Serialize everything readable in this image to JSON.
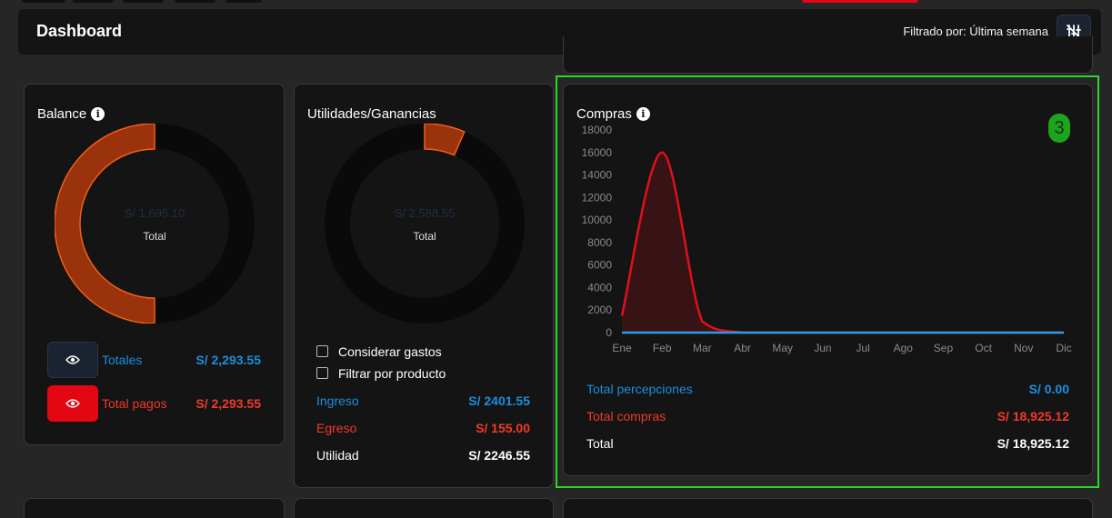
{
  "header": {
    "title": "Dashboard",
    "filter_text": "Filtrado por: Última semana",
    "filter_icon": "sliders-off-icon"
  },
  "balance": {
    "title": "Balance",
    "center_value": "S/ 1,695.10",
    "center_label": "Total",
    "totales_label": "Totales",
    "totales_value": "S/ 2,293.55",
    "total_pagos_label": "Total pagos",
    "total_pagos_value": "S/ 2,293.55",
    "ring_fraction": 0.5,
    "colors": {
      "ring": "#9a320c",
      "ring_stroke": "#f0601a",
      "track": "#0a0a0a",
      "eye_dark": "#1b2230",
      "eye_red": "#e30613"
    }
  },
  "utilidades": {
    "title": "Utilidades/Ganancias",
    "center_value": "S/ 2,588.55",
    "center_label": "Total",
    "checkbox_gastos": "Considerar gastos",
    "checkbox_producto": "Filtrar por producto",
    "ingreso_label": "Ingreso",
    "ingreso_value": "S/ 2401.55",
    "egreso_label": "Egreso",
    "egreso_value": "S/ 155.00",
    "utilidad_label": "Utilidad",
    "utilidad_value": "S/ 2246.55",
    "ring_fraction": 0.065
  },
  "compras": {
    "title": "Compras",
    "badge": "3",
    "total_percepciones_label": "Total percepciones",
    "total_percepciones_value": "S/ 0.00",
    "total_compras_label": "Total compras",
    "total_compras_value": "S/ 18,925.12",
    "total_label": "Total",
    "total_value": "S/ 18,925.12"
  },
  "chart_data": {
    "type": "area",
    "categories": [
      "Ene",
      "Feb",
      "Mar",
      "Abr",
      "May",
      "Jun",
      "Jul",
      "Ago",
      "Sep",
      "Oct",
      "Nov",
      "Dic"
    ],
    "series": [
      {
        "color": "#e0101a",
        "values": [
          1500,
          16000,
          1000,
          0,
          0,
          0,
          0,
          0,
          0,
          0,
          0,
          0
        ]
      },
      {
        "color": "#2a9be6",
        "values": [
          0,
          0,
          0,
          0,
          0,
          0,
          0,
          0,
          0,
          0,
          0,
          0
        ]
      }
    ],
    "yticks": [
      0,
      2000,
      4000,
      6000,
      8000,
      10000,
      12000,
      14000,
      16000,
      18000
    ],
    "ylim": [
      0,
      18000
    ],
    "grid": false
  }
}
